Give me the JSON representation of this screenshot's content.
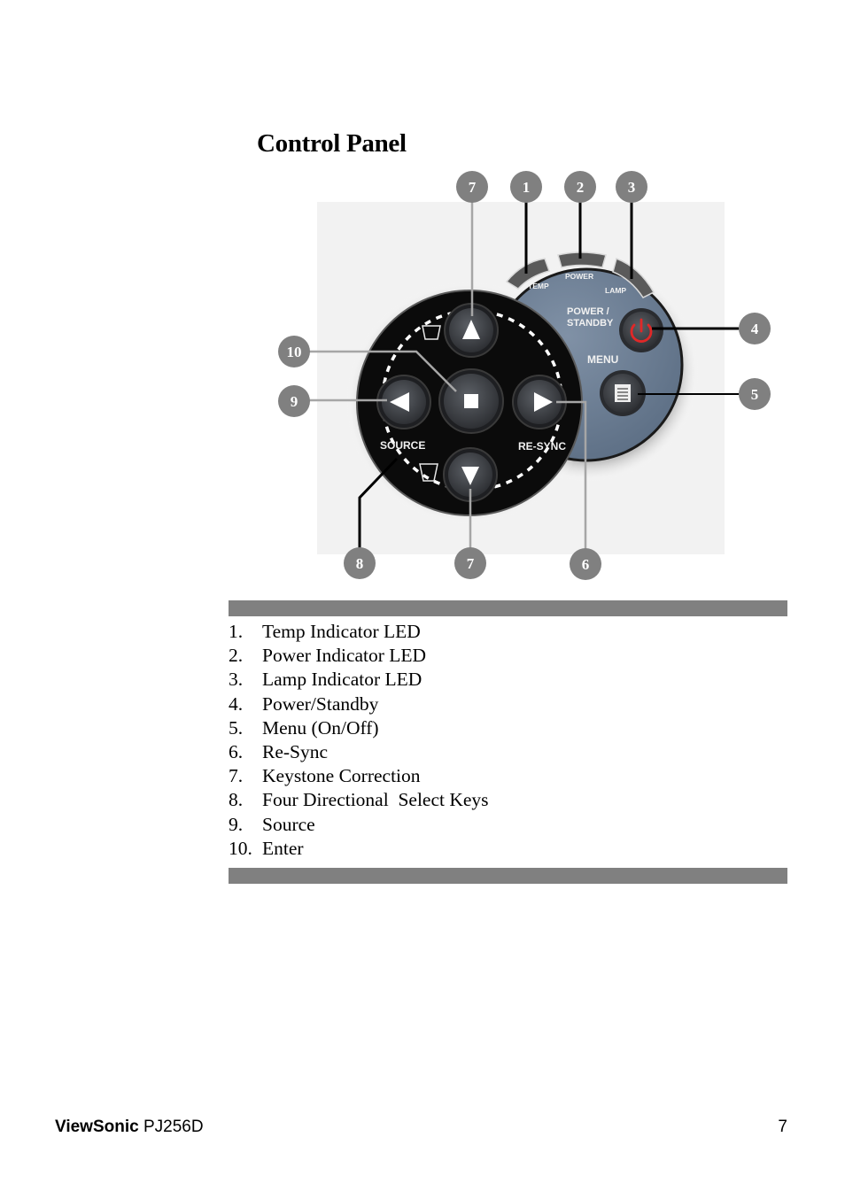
{
  "page": {
    "title": "Control Panel",
    "footer": {
      "brand": "ViewSonic",
      "model": "PJ256D",
      "page_number": "7"
    }
  },
  "panel": {
    "labels": {
      "temp": "TEMP",
      "power": "POWER",
      "lamp": "LAMP",
      "power_standby_line1": "POWER /",
      "power_standby_line2": "STANDBY",
      "menu": "MENU",
      "source": "SOURCE",
      "resync": "RE-SYNC"
    },
    "colors": {
      "panel_blue_gray": "#6f8197",
      "dial_black": "#0b0b0b",
      "button_gray": "#4a4d52",
      "power_icon_red": "#e02828",
      "callout_circle": "#808080",
      "bar_gray": "#808080"
    },
    "callouts": [
      {
        "id": "callout-7-top",
        "label": "7",
        "target": "keystone-up-button"
      },
      {
        "id": "callout-1",
        "label": "1",
        "target": "temp-led"
      },
      {
        "id": "callout-2",
        "label": "2",
        "target": "power-led"
      },
      {
        "id": "callout-3",
        "label": "3",
        "target": "lamp-led"
      },
      {
        "id": "callout-4",
        "label": "4",
        "target": "power-standby-button"
      },
      {
        "id": "callout-5",
        "label": "5",
        "target": "menu-button"
      },
      {
        "id": "callout-10",
        "label": "10",
        "target": "enter-button"
      },
      {
        "id": "callout-9",
        "label": "9",
        "target": "source-button"
      },
      {
        "id": "callout-8",
        "label": "8",
        "target": "directional-ring"
      },
      {
        "id": "callout-7-bottom",
        "label": "7",
        "target": "keystone-down-button"
      },
      {
        "id": "callout-6",
        "label": "6",
        "target": "resync-button"
      }
    ]
  },
  "legend": {
    "items": [
      {
        "num": "1.",
        "text": "Temp Indicator LED"
      },
      {
        "num": "2.",
        "text": "Power Indicator LED"
      },
      {
        "num": "3.",
        "text": "Lamp Indicator LED"
      },
      {
        "num": "4.",
        "text": "Power/Standby"
      },
      {
        "num": "5.",
        "text": "Menu (On/Off)"
      },
      {
        "num": "6.",
        "text": "Re-Sync"
      },
      {
        "num": "7.",
        "text": "Keystone Correction"
      },
      {
        "num": "8.",
        "text": "Four Directional  Select Keys"
      },
      {
        "num": "9.",
        "text": "Source"
      },
      {
        "num": "10.",
        "text": "Enter"
      }
    ]
  }
}
